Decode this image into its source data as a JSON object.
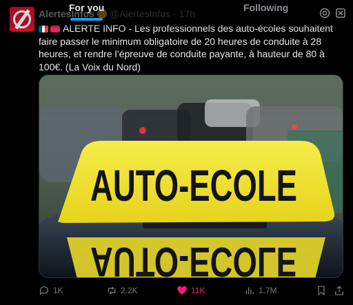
{
  "nav": {
    "tab_for_you": "For you",
    "tab_following": "Following"
  },
  "tweet": {
    "display_name": "AlertesInfos",
    "handle": "@AlertesInfos",
    "separator": "·",
    "time": "17h",
    "text": "ALERTE INFO - Les professionnels des auto-écoles souhaitent faire passer le minimum obligatoire de 20 heures de conduite à 28 heures, et rendre l’épreuve de conduite payante, à hauteur de 80 à 100€. (La Voix du Nord)",
    "media_sign_text": "AUTO-ECOLE"
  },
  "actions": {
    "replies": "1K",
    "reposts": "2.2K",
    "likes": "11K",
    "views": "1.7M"
  },
  "colors": {
    "accent": "#1d9bf0",
    "like": "#f91880",
    "sign_yellow": "#f2e531"
  },
  "icons": [
    "settings-gear-icon",
    "more-icon",
    "reply-icon",
    "repost-icon",
    "heart-icon",
    "views-icon",
    "bookmark-icon",
    "share-icon"
  ]
}
